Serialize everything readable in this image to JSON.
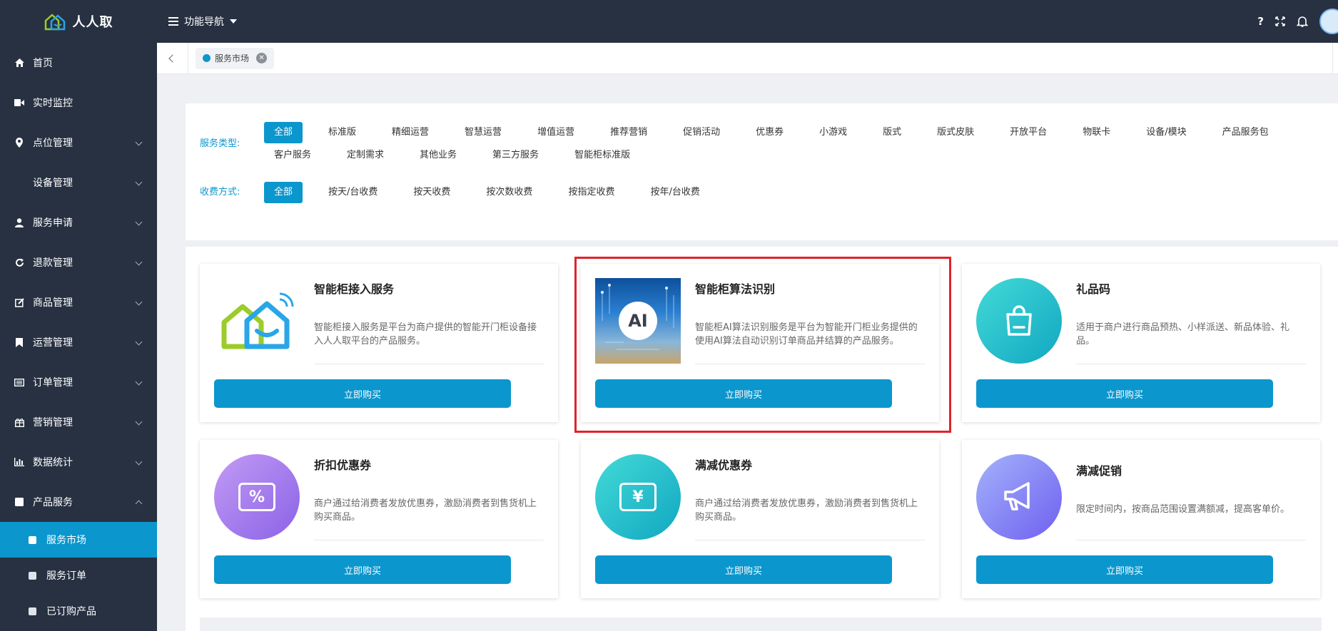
{
  "header": {
    "brand_name": "人人取",
    "func_nav_label": "功能导航",
    "icons": [
      "help-icon",
      "fullscreen-icon",
      "bell-icon",
      "user-avatar"
    ]
  },
  "sidebar": {
    "items": [
      {
        "label": "首页",
        "icon": "home-icon"
      },
      {
        "label": "实时监控",
        "icon": "video-icon"
      },
      {
        "label": "点位管理",
        "icon": "location-pin-icon"
      },
      {
        "label": "设备管理",
        "icon": ""
      },
      {
        "label": "服务申请",
        "icon": "user-icon"
      },
      {
        "label": "退款管理",
        "icon": "refresh-icon"
      },
      {
        "label": "商品管理",
        "icon": "edit-icon"
      },
      {
        "label": "运营管理",
        "icon": "bookmark-icon"
      },
      {
        "label": "订单管理",
        "icon": "list-icon"
      },
      {
        "label": "营销管理",
        "icon": "gift-icon"
      },
      {
        "label": "数据统计",
        "icon": "bar-chart-icon"
      },
      {
        "label": "产品服务",
        "icon": "square-icon"
      }
    ],
    "sub_items": [
      {
        "label": "服务市场",
        "active": true
      },
      {
        "label": "服务订单",
        "active": false
      },
      {
        "label": "已订购产品",
        "active": false
      }
    ]
  },
  "tabs": {
    "active_tab": "服务市场"
  },
  "filters": {
    "service_type_label": "服务类型:",
    "service_types": [
      "全部",
      "标准版",
      "精细运营",
      "智慧运营",
      "增值运营",
      "推荐营销",
      "促销活动",
      "优惠券",
      "小游戏",
      "版式",
      "版式皮肤",
      "开放平台",
      "物联卡",
      "设备/模块",
      "产品服务包",
      "客户服务",
      "定制需求",
      "其他业务",
      "第三方服务",
      "智能柜标准版"
    ],
    "fee_label": "收费方式:",
    "fee_types": [
      "全部",
      "按天/台收费",
      "按天收费",
      "按次数收费",
      "按指定收费",
      "按年/台收费"
    ]
  },
  "cards": [
    {
      "title": "智能柜接入服务",
      "desc": "智能柜接入服务是平台为商户提供的智能开门柜设备接入人人取平台的产品服务。",
      "button": "立即购买",
      "icon": "smart-cabinet-house-icon"
    },
    {
      "title": "智能柜算法识别",
      "desc": "智能柜AI算法识别服务是平台为智能开门柜业务提供的使用AI算法自动识别订单商品并结算的产品服务。",
      "button": "立即购买",
      "icon": "ai-chip-image",
      "badge": "AI"
    },
    {
      "title": "礼品码",
      "desc": "适用于商户进行商品预热、小样派送、新品体验、礼品。",
      "button": "立即购买",
      "icon": "shopping-bag-icon"
    },
    {
      "title": "折扣优惠券",
      "desc": "商户通过给消费者发放优惠券，激励消费者到售货机上购买商品。",
      "button": "立即购买",
      "icon": "discount-coupon-icon",
      "badge": "%"
    },
    {
      "title": "满减优惠券",
      "desc": "商户通过给消费者发放优惠券，激励消费者到售货机上购买商品。",
      "button": "立即购买",
      "icon": "yen-coupon-icon",
      "badge": "¥"
    },
    {
      "title": "满减促销",
      "desc": "限定时间内，按商品范围设置满额减，提高客单价。",
      "button": "立即购买",
      "icon": "megaphone-icon"
    }
  ],
  "colors": {
    "accent": "#0b96cd",
    "sidebar_bg": "#273142",
    "highlight": "#e0232b"
  }
}
